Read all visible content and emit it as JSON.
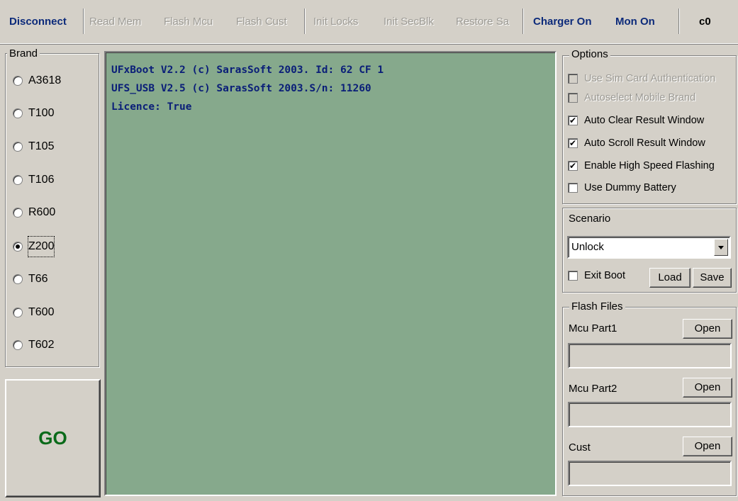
{
  "toolbar": {
    "disconnect": "Disconnect",
    "read_mem": "Read Mem",
    "flash_mcu": "Flash Mcu",
    "flash_cust": "Flash Cust",
    "init_locks": "Init Locks",
    "init_secblk": "Init SecBlk",
    "restore_sa": "Restore Sa",
    "charger_on": "Charger On",
    "mon_on": "Mon On",
    "status_code": "c0"
  },
  "brand": {
    "title": "Brand",
    "selected": "Z200",
    "options": [
      "A3618",
      "T100",
      "T105",
      "T106",
      "R600",
      "Z200",
      "T66",
      "T600",
      "T602"
    ]
  },
  "go_button": "GO",
  "log": {
    "lines": [
      "UFxBoot V2.2 (c) SarasSoft 2003. Id: 62 CF 1",
      "UFS_USB V2.5 (c) SarasSoft 2003.S/n: 11260",
      "Licence: True"
    ]
  },
  "options": {
    "title": "Options",
    "items": [
      {
        "label": "Use Sim Card Authentication",
        "checked": false,
        "enabled": false
      },
      {
        "label": "Autoselect Mobile Brand",
        "checked": false,
        "enabled": false
      },
      {
        "label": "Auto Clear Result Window",
        "checked": true,
        "enabled": true
      },
      {
        "label": "Auto Scroll Result Window",
        "checked": true,
        "enabled": true
      },
      {
        "label": "Enable High Speed Flashing",
        "checked": true,
        "enabled": true
      },
      {
        "label": "Use Dummy Battery",
        "checked": false,
        "enabled": true
      }
    ]
  },
  "scenario": {
    "title": "Scenario",
    "value": "Unlock",
    "exit_boot_label": "Exit Boot",
    "exit_boot_checked": false,
    "load_label": "Load",
    "save_label": "Save"
  },
  "flash_files": {
    "title": "Flash Files",
    "mcu_part1_label": "Mcu Part1",
    "mcu_part2_label": "Mcu Part2",
    "cust_label": "Cust",
    "open_label": "Open"
  },
  "colors": {
    "log_background": "#86a98c",
    "log_text": "#0a1e78",
    "go_text": "#0a6a1a",
    "toolbar_active_text": "#0c2a7a"
  }
}
